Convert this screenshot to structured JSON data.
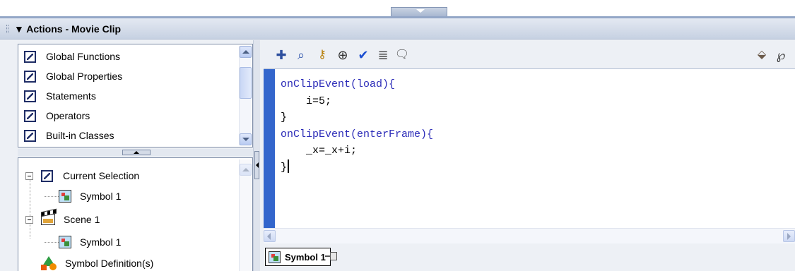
{
  "panel": {
    "title": "Actions - Movie Clip"
  },
  "actions_toolbox": {
    "items": [
      {
        "label": "Global Functions",
        "icon": "book-icon"
      },
      {
        "label": "Global Properties",
        "icon": "book-icon"
      },
      {
        "label": "Statements",
        "icon": "book-icon"
      },
      {
        "label": "Operators",
        "icon": "book-icon"
      },
      {
        "label": "Built-in Classes",
        "icon": "book-icon"
      }
    ]
  },
  "script_navigator": {
    "items": [
      {
        "label": "Current Selection",
        "icon": "book-icon"
      },
      {
        "label": "Symbol 1",
        "icon": "symbol-icon"
      },
      {
        "label": "Scene 1",
        "icon": "scene-icon"
      },
      {
        "label": "Symbol 1",
        "icon": "symbol-icon"
      },
      {
        "label": "Symbol Definition(s)",
        "icon": "shapes-icon"
      }
    ]
  },
  "toolbar": {
    "tools": [
      {
        "name": "add-statement",
        "glyph": "✚"
      },
      {
        "name": "find",
        "glyph": "⌕"
      },
      {
        "name": "insert-target-path",
        "glyph": "⊕"
      },
      {
        "name": "check-syntax",
        "glyph": "✔"
      },
      {
        "name": "auto-format",
        "glyph": "≣"
      },
      {
        "name": "show-code-hint",
        "glyph": "🗨"
      }
    ],
    "right_tools": [
      {
        "name": "debug-options",
        "glyph": "⬙"
      },
      {
        "name": "script-assist",
        "glyph": "℘"
      }
    ]
  },
  "code": {
    "lines": [
      "onClipEvent(load){",
      "    i=5;",
      "}",
      "onClipEvent(enterFrame){",
      "    _x=_x+i;",
      "}"
    ]
  },
  "script_tabs": {
    "active_label": "Symbol 1"
  },
  "colors": {
    "gutter": "#3366cc",
    "keyword": "#2b2bb8",
    "panel_title_bg": "#c6d1e2"
  }
}
